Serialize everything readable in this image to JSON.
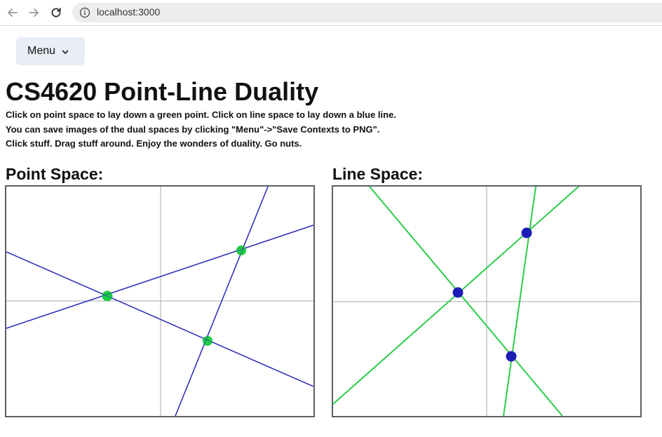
{
  "browser": {
    "url": "localhost:3000"
  },
  "menu": {
    "label": "Menu"
  },
  "header": {
    "title": "CS4620 Point-Line Duality"
  },
  "instructions": [
    "Click on point space to lay down a green point. Click on line space to lay down a blue line.",
    "You can save images of the dual spaces by clicking \"Menu\"->\"Save Contexts to PNG\".",
    "Click stuff. Drag stuff around. Enjoy the wonders of duality. Go nuts."
  ],
  "point_space": {
    "label": "Point Space:"
  },
  "line_space": {
    "label": "Line Space:"
  },
  "colors": {
    "point_green": "#1fcc44",
    "line_blue": "#2c2ab8",
    "dual_line_green": "#2bcc48",
    "dual_point_blue": "#1c1cb8",
    "axis_gray": "#b9b9b9",
    "frame": "#5b6169",
    "menu_bg": "#e8edf6"
  }
}
